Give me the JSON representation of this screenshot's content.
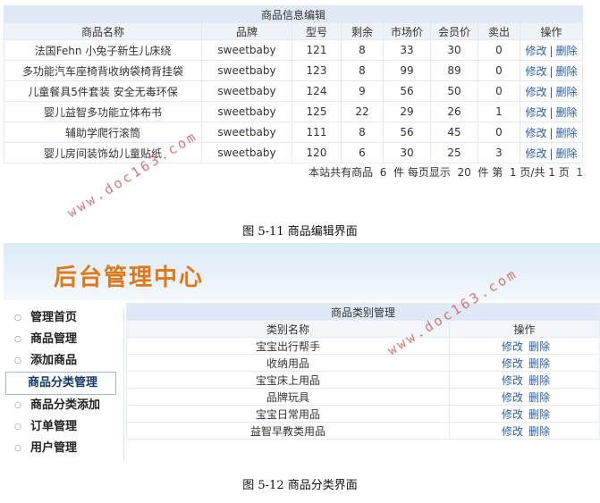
{
  "product_table": {
    "caption": "商品信息编辑",
    "headers": [
      "商品名称",
      "品牌",
      "型号",
      "剩余",
      "市场价",
      "会员价",
      "卖出",
      "操作"
    ],
    "rows": [
      {
        "name": "法国Fehn 小兔子新生儿床绕",
        "brand": "sweetbaby",
        "model": "121",
        "stock": "8",
        "market_price": "33",
        "member_price": "30",
        "sold": "0"
      },
      {
        "name": "多功能汽车座椅背收纳袋椅背挂袋",
        "brand": "sweetbaby",
        "model": "123",
        "stock": "8",
        "market_price": "99",
        "member_price": "89",
        "sold": "0"
      },
      {
        "name": "儿童餐具5件套装 安全无毒环保",
        "brand": "sweetbaby",
        "model": "124",
        "stock": "9",
        "market_price": "56",
        "member_price": "50",
        "sold": "0"
      },
      {
        "name": "婴儿益智多功能立体布书",
        "brand": "sweetbaby",
        "model": "125",
        "stock": "22",
        "market_price": "29",
        "member_price": "26",
        "sold": "1"
      },
      {
        "name": "辅助学爬行滚筒",
        "brand": "sweetbaby",
        "model": "111",
        "stock": "8",
        "market_price": "56",
        "member_price": "45",
        "sold": "0"
      },
      {
        "name": "婴儿房间装饰幼儿童贴纸",
        "brand": "sweetbaby",
        "model": "120",
        "stock": "6",
        "market_price": "30",
        "member_price": "25",
        "sold": "3"
      }
    ],
    "edit_label": "修改",
    "separator": "|",
    "delete_label": "删除",
    "pager": {
      "prefix": "本站共有商品",
      "total": "6",
      "per_page_text": "件 每页显示",
      "per_page": "20",
      "page_text": "件 第",
      "current": "1",
      "total_pages_text": "页/共",
      "total_pages": "1",
      "suffix": "页",
      "page_link": "1"
    }
  },
  "caption1": "图 5-11 商品编辑界面",
  "caption2": "图 5-12 商品分类界面",
  "watermark": "www.doc163.com",
  "banner_title": "后台管理中心",
  "sidebar": {
    "items": [
      {
        "label": "管理首页",
        "active": false
      },
      {
        "label": "商品管理",
        "active": false
      },
      {
        "label": "添加商品",
        "active": false
      },
      {
        "label": "商品分类管理",
        "active": true
      },
      {
        "label": "商品分类添加",
        "active": false
      },
      {
        "label": "订单管理",
        "active": false
      },
      {
        "label": "用户管理",
        "active": false
      }
    ],
    "bullet": "○"
  },
  "category_table": {
    "caption": "商品类别管理",
    "headers": [
      "类别名称",
      "操作"
    ],
    "rows": [
      "宝宝出行帮手",
      "收纳用品",
      "宝宝床上用品",
      "品牌玩具",
      "宝宝日常用品",
      "益智早教类用品"
    ],
    "edit_label": "修改",
    "delete_label": "删除"
  },
  "colors": {
    "link": "#2a5ea8",
    "banner_title": "#e07818",
    "watermark": "#d06060",
    "table_caption_bg": "#dfe9f5"
  }
}
